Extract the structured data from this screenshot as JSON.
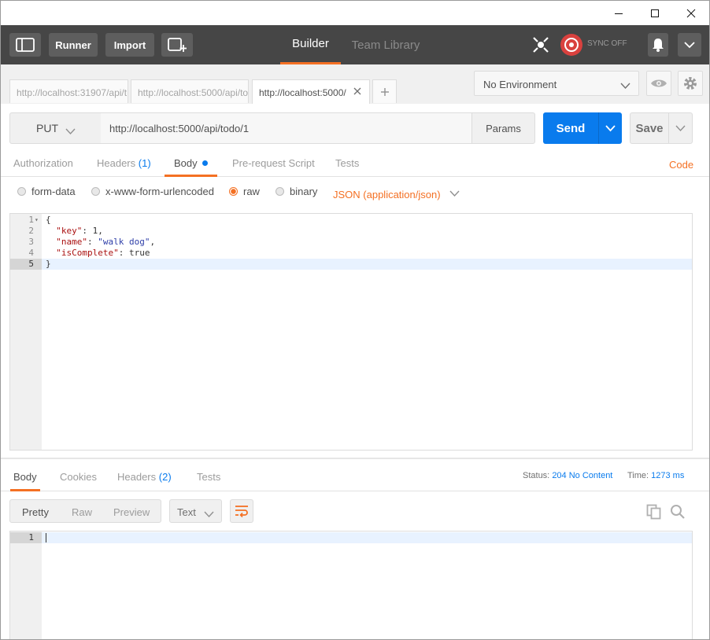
{
  "header": {
    "runner_label": "Runner",
    "import_label": "Import",
    "tabs": [
      {
        "label": "Builder"
      },
      {
        "label": "Team Library"
      }
    ],
    "sync_label": "SYNC OFF"
  },
  "request_tabs": [
    {
      "label": "http://localhost:31907/api/t"
    },
    {
      "label": "http://localhost:5000/api/to"
    },
    {
      "label": "http://localhost:5000/"
    }
  ],
  "environment": {
    "selected": "No Environment"
  },
  "request": {
    "method": "PUT",
    "url": "http://localhost:5000/api/todo/1",
    "params_label": "Params",
    "send_label": "Send",
    "save_label": "Save"
  },
  "request_subtabs": {
    "authorization": "Authorization",
    "headers": "Headers",
    "headers_count": "(1)",
    "body": "Body",
    "prerequest": "Pre-request Script",
    "tests": "Tests",
    "code_link": "Code"
  },
  "body_types": {
    "form_data": "form-data",
    "urlencoded": "x-www-form-urlencoded",
    "raw": "raw",
    "binary": "binary",
    "content_type": "JSON (application/json)"
  },
  "editor": {
    "line_numbers": [
      "1",
      "2",
      "3",
      "4",
      "5"
    ],
    "line1": "{",
    "l2_key": "\"key\"",
    "l2_rest": ": 1,",
    "l3_key": "\"name\"",
    "l3_sep": ": ",
    "l3_val": "\"walk dog\"",
    "l3_end": ",",
    "l4_key": "\"isComplete\"",
    "l4_rest": ": true",
    "line5": "}"
  },
  "response": {
    "tabs": {
      "body": "Body",
      "cookies": "Cookies",
      "headers": "Headers",
      "headers_count": "(2)",
      "tests": "Tests"
    },
    "status_label": "Status:",
    "status_value": "204 No Content",
    "time_label": "Time:",
    "time_value": "1273 ms",
    "view_modes": {
      "pretty": "Pretty",
      "raw": "Raw",
      "preview": "Preview"
    },
    "format": "Text",
    "line_number": "1"
  },
  "colors": {
    "accent": "#f47023",
    "send_blue": "#097bed",
    "header_bg": "#464646"
  }
}
